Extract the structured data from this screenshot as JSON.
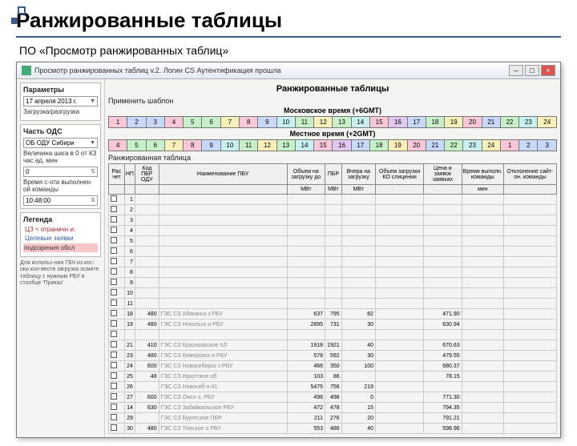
{
  "slide": {
    "title": "Ранжированные таблицы",
    "subtitle": "ПО «Просмотр ранжированных таблиц»"
  },
  "window": {
    "title": "Просмотр ранжированных таблиц v.2. Логин CS Аутентификация прошла"
  },
  "sidebar": {
    "params_hdr": "Параметры",
    "date_value": "17 апреля 2013 г.",
    "load_hdr": "Загрузка/разгрузка",
    "ods_hdr": "Часть ОДС",
    "ods_value": "ОБ ОДУ Сибири",
    "legend_hdr": "Легенда",
    "interval_label": "Величина шага в 0 от КЗ час ад, мин",
    "interval_val": "0",
    "time_label": "Время с-ота выполнен ой команды",
    "time_val": "10:48:00",
    "leg_a": "ЦЗ < отраничн и;",
    "leg_b": "Целевые заявки",
    "leg_c": "подозрения обсл",
    "note": "Для использ-ния ГБЧ из кос-оки кол-веств загрузка осмите таблицу с нужным РБУ в столбце 'Приказ'"
  },
  "main": {
    "title": "Ранжированные таблицы",
    "template_hdr": "Применить шаблон",
    "msk_label": "Московское время (+6GMT)",
    "local_label": "Местное время (+2GMT)",
    "rank_hdr": "Ранжированная таблица",
    "hours_top": [
      "1",
      "2",
      "3",
      "4",
      "5",
      "6",
      "7",
      "8",
      "9",
      "10",
      "11",
      "12",
      "13",
      "14",
      "15",
      "16",
      "17",
      "18",
      "19",
      "20",
      "21",
      "22",
      "23",
      "24"
    ],
    "hours_bot": [
      "4",
      "5",
      "6",
      "7",
      "8",
      "9",
      "10",
      "11",
      "12",
      "13",
      "14",
      "15",
      "16",
      "17",
      "18",
      "19",
      "20",
      "21",
      "22",
      "23",
      "24",
      "1",
      "2",
      "3"
    ],
    "cols": {
      "sel": "Рас чет",
      "np": "НП",
      "kod": "Код ПБР ОДУ",
      "name": "Наименование ПБУ",
      "vol_up": "Объем на загрузку до",
      "pbr": "ПБР",
      "vchera": "Вчера на загрузку",
      "vol_ko": "Объем загрузки КО слицении",
      "price": "Цена и заявок заявках",
      "time": "Время выполн. команды",
      "dev": "Отклонение сайт-он. команды"
    },
    "units": {
      "mvt1": "МВт",
      "mvt2": "МВт",
      "mvt3": "МВт",
      "min": "мин"
    },
    "rows": [
      {
        "n": "1",
        "k": "",
        "name": "",
        "v": "",
        "p": "",
        "s": "",
        "r": "",
        "t": ""
      },
      {
        "n": "2",
        "k": "",
        "name": "",
        "v": "",
        "p": "",
        "s": "",
        "r": "",
        "t": ""
      },
      {
        "n": "3",
        "k": "",
        "name": "",
        "v": "",
        "p": "",
        "s": "",
        "r": "",
        "t": ""
      },
      {
        "n": "4",
        "k": "",
        "name": "",
        "v": "",
        "p": "",
        "s": "",
        "r": "",
        "t": ""
      },
      {
        "n": "5",
        "k": "",
        "name": "",
        "v": "",
        "p": "",
        "s": "",
        "r": "",
        "t": ""
      },
      {
        "n": "6",
        "k": "",
        "name": "",
        "v": "",
        "p": "",
        "s": "",
        "r": "",
        "t": ""
      },
      {
        "n": "7",
        "k": "",
        "name": "",
        "v": "",
        "p": "",
        "s": "",
        "r": "",
        "t": ""
      },
      {
        "n": "8",
        "k": "",
        "name": "",
        "v": "",
        "p": "",
        "s": "",
        "r": "",
        "t": ""
      },
      {
        "n": "9",
        "k": "",
        "name": "",
        "v": "",
        "p": "",
        "s": "",
        "r": "",
        "t": ""
      },
      {
        "n": "10",
        "k": "",
        "name": "",
        "v": "",
        "p": "",
        "s": "",
        "r": "",
        "t": ""
      },
      {
        "n": "11",
        "k": "",
        "name": "",
        "v": "",
        "p": "",
        "s": "",
        "r": "",
        "t": ""
      },
      {
        "n": "18",
        "k": "480",
        "name": "ГЭС СЗ Абаканск з РБУ",
        "v": "637",
        "p": "795",
        "s": "82",
        "r": "471.90",
        "t": ""
      },
      {
        "n": "19",
        "k": "480",
        "name": "ГЭС СЗ Нскольск и РБУ",
        "v": "2895",
        "p": "731",
        "s": "30",
        "r": "630.94",
        "t": ""
      },
      {
        "n": "",
        "k": "",
        "name": "",
        "v": "",
        "p": "",
        "s": "",
        "r": "",
        "t": ""
      },
      {
        "n": "21",
        "k": "410",
        "name": "ГЭС СЗ Красноярское КЛ",
        "v": "1918",
        "p": "1921",
        "s": "40",
        "r": "670.63",
        "t": ""
      },
      {
        "n": "23",
        "k": "480",
        "name": "ГЭС СЗ Кемеровск и РБУ",
        "v": "578",
        "p": "592",
        "s": "30",
        "r": "479.55",
        "t": ""
      },
      {
        "n": "24",
        "k": "600",
        "name": "ГЭС СЗ Новосибирск з РБУ",
        "v": "466",
        "p": "350",
        "s": "100",
        "r": "680.37",
        "t": ""
      },
      {
        "n": "25",
        "k": "48",
        "name": "ГЭС СЗ Иркутское об",
        "v": "103",
        "p": "86",
        "s": "",
        "r": "78.15",
        "t": ""
      },
      {
        "n": "26",
        "k": "",
        "name": "ГЭС СЗ Новосиб н-41",
        "v": "5475",
        "p": "756",
        "s": "219",
        "r": "",
        "t": ""
      },
      {
        "n": "27",
        "k": "600",
        "name": "ГЭС СЗ Омск о, РБУ",
        "v": "498",
        "p": "498",
        "s": "0",
        "r": "771.30",
        "t": ""
      },
      {
        "n": "14",
        "k": "630",
        "name": "ГЭС СЗ Забайкальское РБУ",
        "v": "472",
        "p": "478",
        "s": "15",
        "r": "794.35",
        "t": ""
      },
      {
        "n": "29",
        "k": "",
        "name": "ГЭС СЗ Бурятское ПБР",
        "v": "211",
        "p": "276",
        "s": "20",
        "r": "791.21",
        "t": ""
      },
      {
        "n": "30",
        "k": "480",
        "name": "ГЭС СЗ Томское о РБУ",
        "v": "553",
        "p": "486",
        "s": "40",
        "r": "598.96",
        "t": ""
      }
    ]
  }
}
